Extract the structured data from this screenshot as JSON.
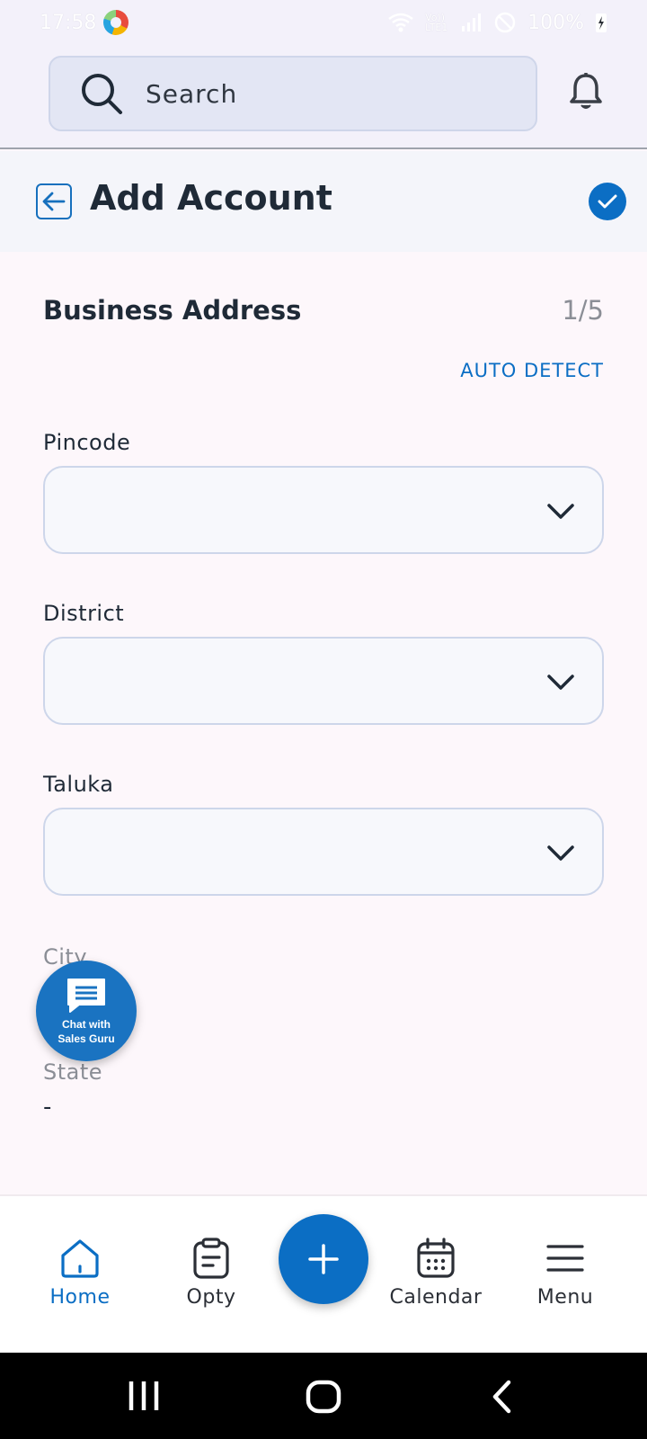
{
  "status_bar": {
    "time": "17:58",
    "network": "Vo)) LTE1",
    "battery": "100%",
    "icons": [
      "app-notification-icon",
      "wifi-icon",
      "volte-icon",
      "signal-icon",
      "do-not-disturb-icon",
      "battery-charging-icon"
    ]
  },
  "header": {
    "search": {
      "placeholder": "Search",
      "icon": "search-icon"
    },
    "notification_icon": "bell-icon"
  },
  "page": {
    "title": "Add Account",
    "back_icon": "back-arrow-icon",
    "confirm_icon": "check-circle-icon"
  },
  "form": {
    "section_title": "Business Address",
    "step": "1/5",
    "auto_detect": "AUTO DETECT",
    "fields": [
      {
        "label": "Pincode",
        "value": ""
      },
      {
        "label": "District",
        "value": ""
      },
      {
        "label": "Taluka",
        "value": ""
      }
    ],
    "city": {
      "label": "City",
      "value": ""
    },
    "state": {
      "label": "State",
      "value": "-"
    }
  },
  "chat": {
    "label_line1": "Chat with",
    "label_line2": "Sales Guru",
    "icon": "chat-bubble-icon"
  },
  "bottom_nav": {
    "items": [
      {
        "label": "Home",
        "icon": "home-icon",
        "active": true
      },
      {
        "label": "Opty",
        "icon": "clipboard-icon",
        "active": false
      },
      {
        "label": "Calendar",
        "icon": "calendar-icon",
        "active": false
      },
      {
        "label": "Menu",
        "icon": "hamburger-menu-icon",
        "active": false
      }
    ],
    "add_icon": "plus-icon"
  },
  "colors": {
    "accent": "#0b6ec4",
    "background": "#fdf7fb",
    "header_bg": "#f3f1fa",
    "search_bg": "#e3e6f4",
    "text": "#1f2a37",
    "muted": "#8b8e96"
  }
}
